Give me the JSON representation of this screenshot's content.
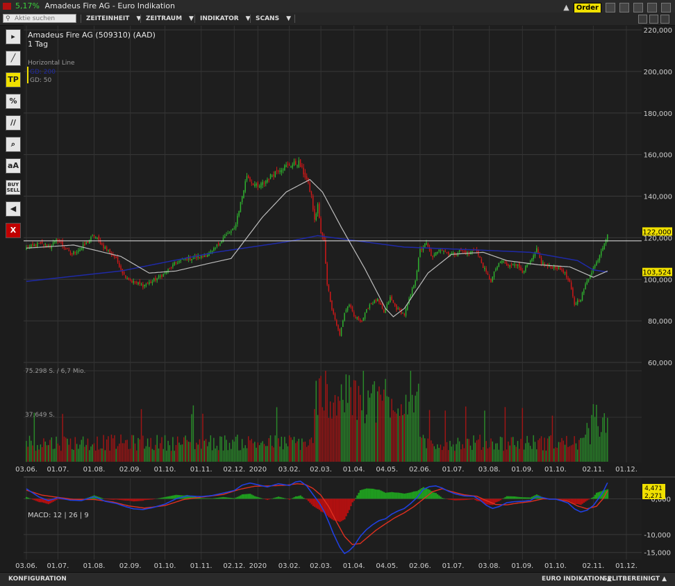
{
  "window": {
    "change_pct": "5,17%",
    "title": "Amadeus Fire AG - Euro Indikation",
    "order_label": "Order"
  },
  "menubar": {
    "search_placeholder": "Aktie suchen",
    "items": [
      "ZEITEINHEIT",
      "ZEITRAUM",
      "INDIKATOR",
      "SCANS"
    ]
  },
  "toolbar": {
    "tools": [
      {
        "name": "cursor-tool",
        "label": "▸",
        "style": ""
      },
      {
        "name": "line-tool",
        "label": "╱",
        "style": ""
      },
      {
        "name": "tp-tool",
        "label": "TP",
        "style": "yellow"
      },
      {
        "name": "percent-tool",
        "label": "%",
        "style": ""
      },
      {
        "name": "channel-tool",
        "label": "//",
        "style": ""
      },
      {
        "name": "zoom-tool",
        "label": "⌕",
        "style": ""
      },
      {
        "name": "text-tool",
        "label": "aA",
        "style": ""
      },
      {
        "name": "buy-sell-tool",
        "label": "BUY SELL",
        "style": "small"
      },
      {
        "name": "sound-tool",
        "label": "◀",
        "style": ""
      },
      {
        "name": "close-tool",
        "label": "X",
        "style": "red"
      }
    ]
  },
  "statusbar": {
    "left": "KONFIGURATION",
    "right1": "EURO INDIKATION ▲",
    "right2": "SPLITBEREINIGT ▲"
  },
  "colors": {
    "up": "#2fb22f",
    "down": "#d01818",
    "sma200": "#1f2aa8",
    "sma50": "#bdbdbd",
    "macd_line": "#2040e0",
    "signal_line": "#e03020",
    "hist_pos": "#1f9b1f",
    "hist_neg": "#b01010",
    "label_bg": "#f0e000"
  },
  "chart_data": [
    {
      "type": "candlestick",
      "title": "Amadeus Fire AG (509310) (AAD)",
      "subtitle": "1 Tag",
      "legend": [
        "Horizontal Line",
        "GD: 200",
        "GD: 50"
      ],
      "y_ticks": [
        60000,
        80000,
        100000,
        120000,
        140000,
        160000,
        180000,
        200000,
        220000
      ],
      "y_tick_labels": [
        "60,000",
        "80,000",
        "100,000",
        "120,000",
        "140,000",
        "160,000",
        "180,000",
        "200,000",
        "220,000"
      ],
      "ylim": [
        54000,
        222000
      ],
      "x_tick_labels": [
        "03.06.",
        "01.07.",
        "01.08.",
        "02.09.",
        "01.10.",
        "01.11.",
        "02.12.",
        "2020",
        "03.02.",
        "02.03.",
        "01.04.",
        "04.05.",
        "02.06.",
        "01.07.",
        "03.08.",
        "01.09.",
        "01.10.",
        "02.11.",
        "01.12."
      ],
      "x_tick_index": [
        0,
        20,
        43,
        66,
        88,
        111,
        132,
        147,
        167,
        187,
        208,
        229,
        250,
        271,
        294,
        315,
        336,
        360,
        381
      ],
      "horizontal_line": 118500,
      "last_price_label": "122,000",
      "last_price": 122000,
      "sma200_label": "103,524",
      "sma200_last": 103524,
      "anchors_close": [
        [
          0,
          115000
        ],
        [
          8,
          117000
        ],
        [
          15,
          116000
        ],
        [
          20,
          119000
        ],
        [
          28,
          112000
        ],
        [
          35,
          115000
        ],
        [
          43,
          121000
        ],
        [
          50,
          115000
        ],
        [
          57,
          110000
        ],
        [
          62,
          102000
        ],
        [
          67,
          99000
        ],
        [
          74,
          97000
        ],
        [
          80,
          99000
        ],
        [
          88,
          103000
        ],
        [
          95,
          108000
        ],
        [
          102,
          110000
        ],
        [
          111,
          111000
        ],
        [
          118,
          113000
        ],
        [
          125,
          120000
        ],
        [
          132,
          124000
        ],
        [
          137,
          140000
        ],
        [
          140,
          150000
        ],
        [
          143,
          147000
        ],
        [
          147,
          144000
        ],
        [
          153,
          148000
        ],
        [
          160,
          153000
        ],
        [
          167,
          155000
        ],
        [
          173,
          156000
        ],
        [
          178,
          148000
        ],
        [
          181,
          140000
        ],
        [
          183,
          128000
        ],
        [
          185,
          136000
        ],
        [
          187,
          122000
        ],
        [
          189,
          118000
        ],
        [
          191,
          98000
        ],
        [
          194,
          86000
        ],
        [
          199,
          73000
        ],
        [
          202,
          84000
        ],
        [
          205,
          88000
        ],
        [
          208,
          82000
        ],
        [
          213,
          80000
        ],
        [
          218,
          88000
        ],
        [
          223,
          90000
        ],
        [
          227,
          84000
        ],
        [
          231,
          91000
        ],
        [
          235,
          86000
        ],
        [
          240,
          83000
        ],
        [
          243,
          90000
        ],
        [
          247,
          100000
        ],
        [
          250,
          114000
        ],
        [
          254,
          117000
        ],
        [
          258,
          110000
        ],
        [
          262,
          115000
        ],
        [
          267,
          113000
        ],
        [
          271,
          112000
        ],
        [
          276,
          114000
        ],
        [
          281,
          112000
        ],
        [
          285,
          115000
        ],
        [
          289,
          108000
        ],
        [
          292,
          103000
        ],
        [
          295,
          99000
        ],
        [
          298,
          105000
        ],
        [
          302,
          109000
        ],
        [
          306,
          106000
        ],
        [
          310,
          108000
        ],
        [
          315,
          104000
        ],
        [
          320,
          108000
        ],
        [
          324,
          114000
        ],
        [
          327,
          108000
        ],
        [
          331,
          106000
        ],
        [
          336,
          106000
        ],
        [
          341,
          104000
        ],
        [
          345,
          98000
        ],
        [
          348,
          88000
        ],
        [
          352,
          91000
        ],
        [
          356,
          99000
        ],
        [
          359,
          104000
        ],
        [
          362,
          108000
        ],
        [
          365,
          114000
        ],
        [
          367,
          118000
        ],
        [
          369,
          122000
        ]
      ],
      "sma200": [
        [
          0,
          99000
        ],
        [
          60,
          104000
        ],
        [
          120,
          113000
        ],
        [
          165,
          118000
        ],
        [
          185,
          121000
        ],
        [
          205,
          119000
        ],
        [
          240,
          115500
        ],
        [
          290,
          114000
        ],
        [
          320,
          113000
        ],
        [
          350,
          109000
        ],
        [
          360,
          104500
        ],
        [
          369,
          103524
        ]
      ],
      "sma50": [
        [
          0,
          115000
        ],
        [
          30,
          116500
        ],
        [
          60,
          111000
        ],
        [
          78,
          103000
        ],
        [
          95,
          104000
        ],
        [
          115,
          107500
        ],
        [
          130,
          110000
        ],
        [
          150,
          130000
        ],
        [
          165,
          142000
        ],
        [
          180,
          148000
        ],
        [
          188,
          142000
        ],
        [
          200,
          125000
        ],
        [
          215,
          105000
        ],
        [
          228,
          86000
        ],
        [
          233,
          82000
        ],
        [
          240,
          86000
        ],
        [
          255,
          103000
        ],
        [
          270,
          112000
        ],
        [
          290,
          113000
        ],
        [
          305,
          109000
        ],
        [
          325,
          107000
        ],
        [
          345,
          106000
        ],
        [
          360,
          101000
        ],
        [
          369,
          104000
        ]
      ]
    },
    {
      "type": "bar",
      "name": "volume",
      "labels": [
        "75.298 S. / 6,7 Mio.",
        "37.649 S."
      ],
      "max_shares": 75298
    },
    {
      "type": "line",
      "title": "MACD: 12 | 26 | 9",
      "y_ticks": [
        0,
        -10000,
        -15000
      ],
      "y_tick_labels": [
        "0,000",
        "-10,000",
        "-15,000"
      ],
      "ylim": [
        -17000,
        5500
      ],
      "macd_label": "4,471",
      "signal_label": "2,271",
      "macd": [
        [
          0,
          2800
        ],
        [
          8,
          500
        ],
        [
          14,
          -500
        ],
        [
          20,
          300
        ],
        [
          28,
          -400
        ],
        [
          35,
          -500
        ],
        [
          43,
          600
        ],
        [
          50,
          -700
        ],
        [
          57,
          -1300
        ],
        [
          63,
          -2200
        ],
        [
          68,
          -2800
        ],
        [
          74,
          -3000
        ],
        [
          80,
          -2500
        ],
        [
          88,
          -1500
        ],
        [
          95,
          0
        ],
        [
          102,
          800
        ],
        [
          111,
          600
        ],
        [
          118,
          900
        ],
        [
          125,
          1600
        ],
        [
          132,
          2300
        ],
        [
          137,
          3800
        ],
        [
          142,
          4400
        ],
        [
          147,
          3900
        ],
        [
          153,
          3300
        ],
        [
          160,
          4200
        ],
        [
          167,
          3700
        ],
        [
          171,
          4700
        ],
        [
          174,
          4900
        ],
        [
          178,
          3600
        ],
        [
          182,
          1200
        ],
        [
          186,
          -1200
        ],
        [
          189,
          -3500
        ],
        [
          192,
          -6500
        ],
        [
          195,
          -9800
        ],
        [
          199,
          -13500
        ],
        [
          202,
          -15300
        ],
        [
          205,
          -14500
        ],
        [
          208,
          -13200
        ],
        [
          212,
          -10500
        ],
        [
          216,
          -8600
        ],
        [
          220,
          -7200
        ],
        [
          224,
          -6100
        ],
        [
          228,
          -5600
        ],
        [
          232,
          -4300
        ],
        [
          236,
          -3400
        ],
        [
          240,
          -2700
        ],
        [
          244,
          -1300
        ],
        [
          248,
          300
        ],
        [
          252,
          2600
        ],
        [
          256,
          3400
        ],
        [
          260,
          3600
        ],
        [
          264,
          3000
        ],
        [
          268,
          2100
        ],
        [
          272,
          1400
        ],
        [
          278,
          800
        ],
        [
          284,
          700
        ],
        [
          288,
          -300
        ],
        [
          292,
          -1800
        ],
        [
          296,
          -2700
        ],
        [
          300,
          -2200
        ],
        [
          305,
          -1100
        ],
        [
          310,
          -800
        ],
        [
          315,
          -700
        ],
        [
          320,
          -500
        ],
        [
          324,
          600
        ],
        [
          328,
          300
        ],
        [
          332,
          -100
        ],
        [
          336,
          -100
        ],
        [
          340,
          -600
        ],
        [
          344,
          -1200
        ],
        [
          348,
          -2800
        ],
        [
          352,
          -3700
        ],
        [
          356,
          -3200
        ],
        [
          360,
          -1900
        ],
        [
          363,
          -100
        ],
        [
          366,
          1800
        ],
        [
          369,
          4471
        ]
      ],
      "signal": [
        [
          0,
          2400
        ],
        [
          10,
          1000
        ],
        [
          20,
          400
        ],
        [
          30,
          -200
        ],
        [
          43,
          -200
        ],
        [
          55,
          -900
        ],
        [
          65,
          -2000
        ],
        [
          75,
          -2600
        ],
        [
          88,
          -1900
        ],
        [
          100,
          -200
        ],
        [
          112,
          500
        ],
        [
          125,
          1200
        ],
        [
          135,
          2600
        ],
        [
          145,
          3500
        ],
        [
          155,
          3600
        ],
        [
          165,
          3800
        ],
        [
          172,
          4200
        ],
        [
          177,
          4000
        ],
        [
          182,
          2900
        ],
        [
          187,
          1000
        ],
        [
          192,
          -2200
        ],
        [
          197,
          -6500
        ],
        [
          202,
          -10500
        ],
        [
          207,
          -12800
        ],
        [
          212,
          -12500
        ],
        [
          216,
          -11000
        ],
        [
          222,
          -8800
        ],
        [
          228,
          -7000
        ],
        [
          234,
          -5300
        ],
        [
          240,
          -3900
        ],
        [
          246,
          -2200
        ],
        [
          252,
          -100
        ],
        [
          258,
          2000
        ],
        [
          264,
          2800
        ],
        [
          270,
          2000
        ],
        [
          278,
          1100
        ],
        [
          286,
          700
        ],
        [
          292,
          -500
        ],
        [
          298,
          -1600
        ],
        [
          305,
          -1700
        ],
        [
          312,
          -1200
        ],
        [
          320,
          -800
        ],
        [
          328,
          0
        ],
        [
          336,
          -100
        ],
        [
          344,
          -700
        ],
        [
          350,
          -2000
        ],
        [
          356,
          -2800
        ],
        [
          362,
          -2100
        ],
        [
          366,
          -100
        ],
        [
          369,
          2271
        ]
      ]
    }
  ]
}
